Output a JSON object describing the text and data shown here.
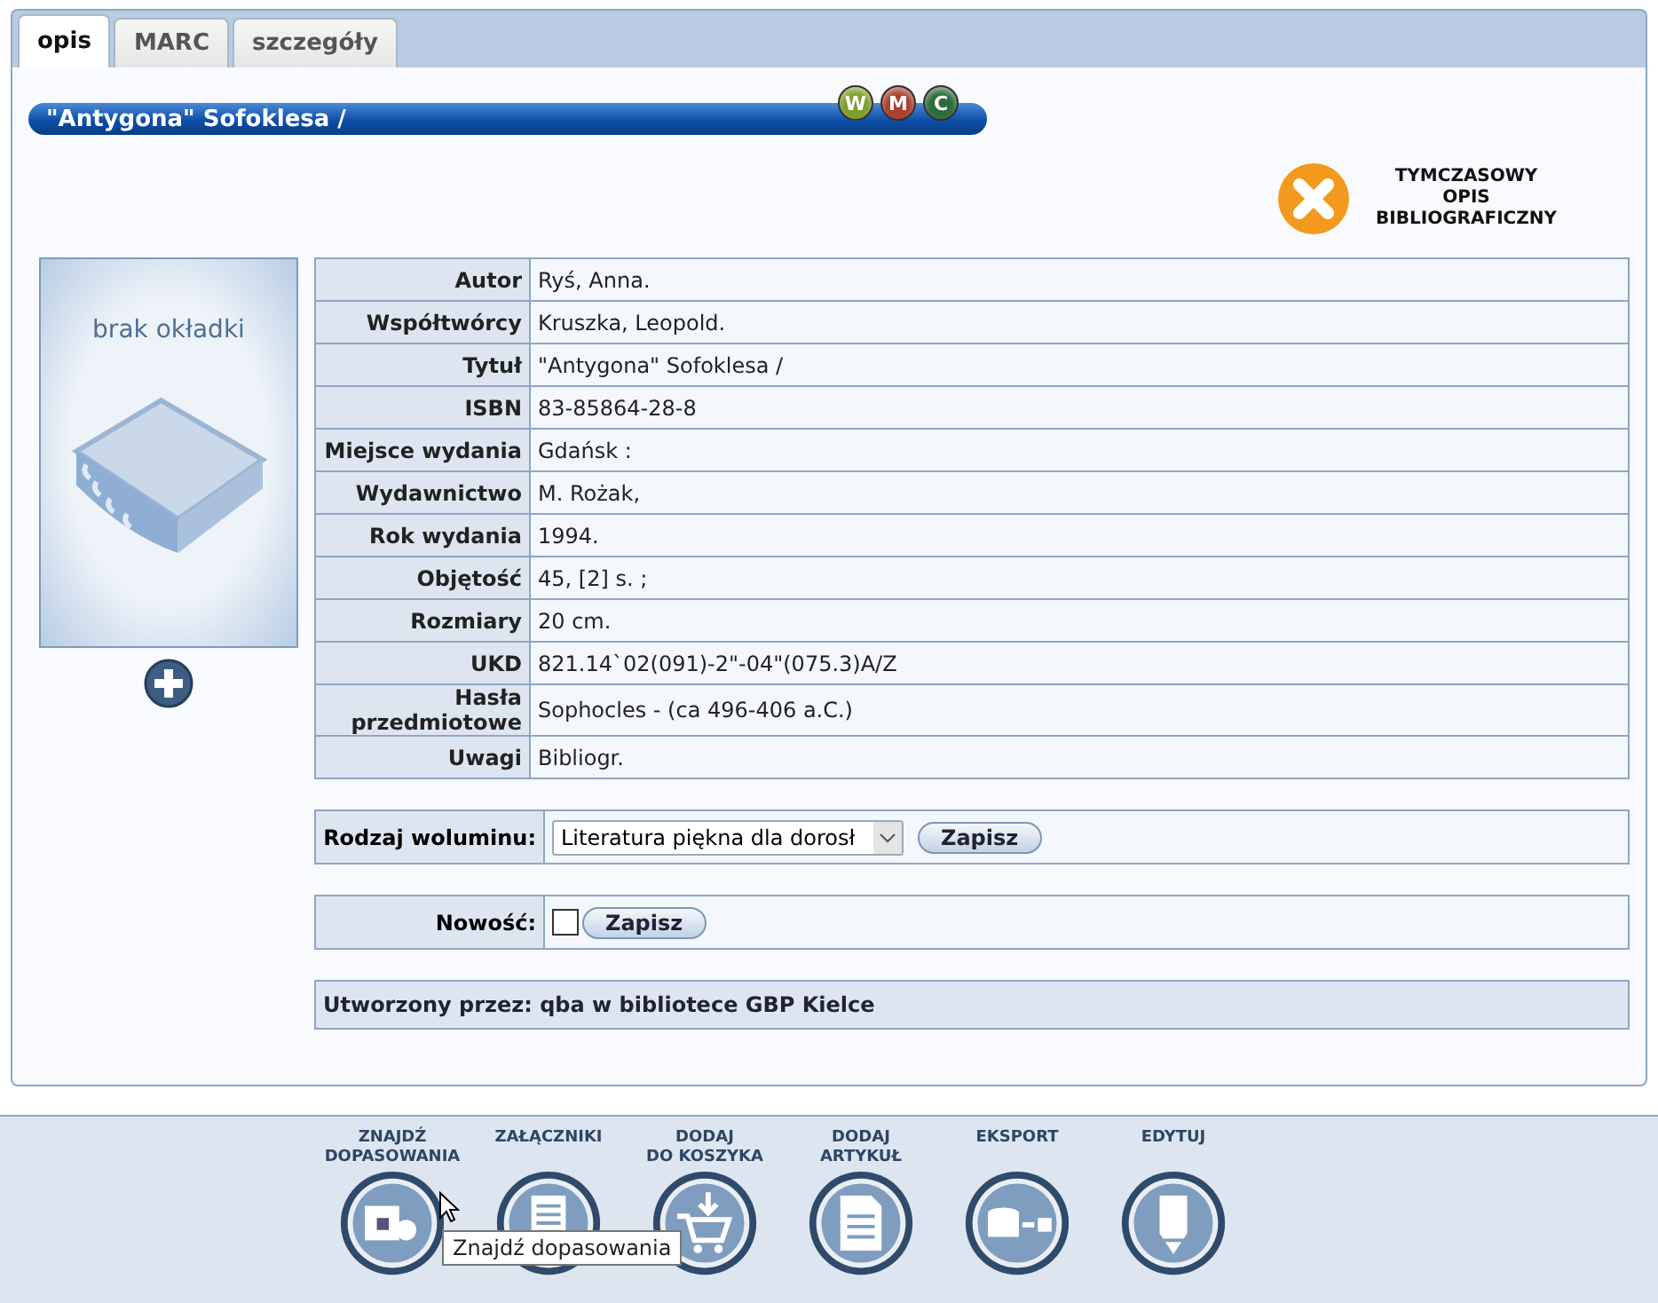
{
  "tabs": [
    {
      "label": "opis",
      "selected": true
    },
    {
      "label": "MARC",
      "selected": false
    },
    {
      "label": "szczegóły",
      "selected": false
    }
  ],
  "record": {
    "title": "\"Antygona\" Sofoklesa /",
    "badges": [
      {
        "label": "W",
        "color": "#7f9e2c"
      },
      {
        "label": "M",
        "color": "#a8402e"
      },
      {
        "label": "C",
        "color": "#2d6b3c"
      }
    ],
    "status": {
      "lines": [
        "TYMCZASOWY",
        "OPIS",
        "BIBLIOGRAFICZNY"
      ]
    },
    "cover": {
      "text": "brak okładki"
    },
    "fields": [
      {
        "label": "Autor",
        "value": "Ryś, Anna."
      },
      {
        "label": "Współtwórcy",
        "value": "Kruszka, Leopold."
      },
      {
        "label": "Tytuł",
        "value": "\"Antygona\" Sofoklesa /"
      },
      {
        "label": "ISBN",
        "value": "83-85864-28-8"
      },
      {
        "label": "Miejsce wydania",
        "value": "Gdańsk :"
      },
      {
        "label": "Wydawnictwo",
        "value": "M. Rożak,"
      },
      {
        "label": "Rok wydania",
        "value": "1994."
      },
      {
        "label": "Objętość",
        "value": "45, [2] s. ;"
      },
      {
        "label": "Rozmiary",
        "value": "20 cm."
      },
      {
        "label": "UKD",
        "value": "821.14`02(091)-2\"-04\"(075.3)A/Z"
      },
      {
        "label": "Hasła przedmiotowe",
        "value": "Sophocles - (ca 496-406 a.C.)"
      },
      {
        "label": "Uwagi",
        "value": "Bibliogr."
      }
    ],
    "volume_type": {
      "label": "Rodzaj woluminu:",
      "value": "Literatura piękna dla dorosł",
      "button": "Zapisz"
    },
    "novelty": {
      "label": "Nowość:",
      "checked": false,
      "button": "Zapisz"
    },
    "created_by": "Utworzony przez: qba w bibliotece GBP Kielce"
  },
  "toolbar": [
    {
      "label": [
        "ZNAJDŹ",
        "DOPASOWANIA"
      ]
    },
    {
      "label": [
        "ZAŁĄCZNIKI"
      ]
    },
    {
      "label": [
        "DODAJ",
        "DO KOSZYKA"
      ]
    },
    {
      "label": [
        "DODAJ",
        "ARTYKUŁ"
      ]
    },
    {
      "label": [
        "EKSPORT"
      ]
    },
    {
      "label": [
        "EDYTUJ"
      ]
    }
  ],
  "tooltip": "Znajdź dopasowania"
}
